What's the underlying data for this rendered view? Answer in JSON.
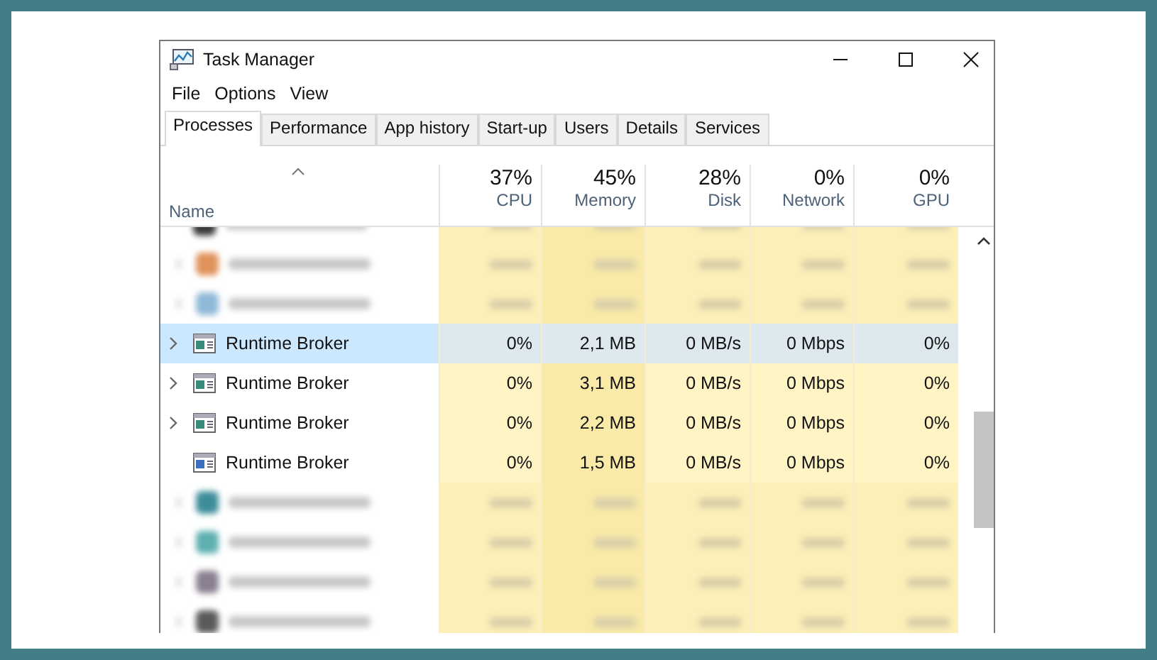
{
  "window": {
    "title": "Task Manager"
  },
  "menu": [
    "File",
    "Options",
    "View"
  ],
  "tabs": [
    {
      "label": "Processes",
      "selected": true
    },
    {
      "label": "Performance",
      "selected": false
    },
    {
      "label": "App history",
      "selected": false
    },
    {
      "label": "Start-up",
      "selected": false
    },
    {
      "label": "Users",
      "selected": false
    },
    {
      "label": "Details",
      "selected": false
    },
    {
      "label": "Services",
      "selected": false
    }
  ],
  "table": {
    "columns": [
      {
        "label": "Name"
      },
      {
        "label": "CPU",
        "usage": "37%"
      },
      {
        "label": "Memory",
        "usage": "45%"
      },
      {
        "label": "Disk",
        "usage": "28%"
      },
      {
        "label": "Network",
        "usage": "0%"
      },
      {
        "label": "GPU",
        "usage": "0%"
      }
    ],
    "rows": [
      {
        "kind": "blurred",
        "expandable": false,
        "color": "#3a3a3a"
      },
      {
        "kind": "blurred",
        "expandable": true,
        "color": "#e0925a"
      },
      {
        "kind": "blurred",
        "expandable": true,
        "color": "#8fb9d8"
      },
      {
        "kind": "process",
        "name": "Runtime Broker",
        "expandable": true,
        "selected": true,
        "cells": [
          "0%",
          "2,1 MB",
          "0 MB/s",
          "0 Mbps",
          "0%"
        ]
      },
      {
        "kind": "process",
        "name": "Runtime Broker",
        "expandable": true,
        "selected": false,
        "cells": [
          "0%",
          "3,1 MB",
          "0 MB/s",
          "0 Mbps",
          "0%"
        ]
      },
      {
        "kind": "process",
        "name": "Runtime Broker",
        "expandable": true,
        "selected": false,
        "cells": [
          "0%",
          "2,2 MB",
          "0 MB/s",
          "0 Mbps",
          "0%"
        ]
      },
      {
        "kind": "process",
        "name": "Runtime Broker",
        "expandable": false,
        "selected": false,
        "cells": [
          "0%",
          "1,5 MB",
          "0 MB/s",
          "0 Mbps",
          "0%"
        ]
      },
      {
        "kind": "blurred",
        "expandable": true,
        "color": "#3d8d9a"
      },
      {
        "kind": "blurred",
        "expandable": true,
        "color": "#5fb0b0"
      },
      {
        "kind": "blurred",
        "expandable": true,
        "color": "#8a8090"
      },
      {
        "kind": "blurred",
        "expandable": true,
        "color": "#5a5a5a"
      }
    ]
  }
}
